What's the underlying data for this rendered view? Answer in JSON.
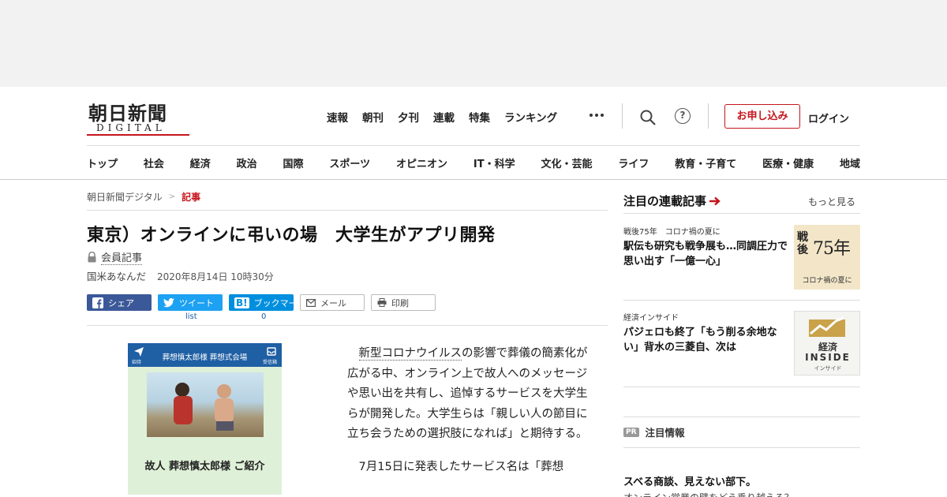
{
  "logo": {
    "jp": "朝日新聞",
    "en": "DIGITAL"
  },
  "topnav": [
    "速報",
    "朝刊",
    "夕刊",
    "連載",
    "特集",
    "ランキング"
  ],
  "header": {
    "signup": "お申し込み",
    "login": "ログイン",
    "help": "?"
  },
  "catnav": [
    "トップ",
    "社会",
    "経済",
    "政治",
    "国際",
    "スポーツ",
    "オピニオン",
    "IT・科学",
    "文化・芸能",
    "ライフ",
    "教育・子育て",
    "医療・健康",
    "地域"
  ],
  "breadcrumb": {
    "home": "朝日新聞デジタル",
    "sep": ">",
    "current": "記事"
  },
  "article": {
    "title": "東京）オンラインに弔いの場　大学生がアプリ開発",
    "member": "会員記事",
    "author": "国米あなんだ",
    "date": "2020年8月14日 10時30分",
    "share": {
      "fb": "シェア",
      "tw": "ツイート",
      "hb": "ブックマーク",
      "mail": "メール",
      "print": "印刷",
      "tw_count": "list",
      "hb_count": "0"
    },
    "photo": {
      "header": "葬想慎太郎様 葬想式会場",
      "left_label": "招待",
      "right_label": "受信箱",
      "caption": "故人 葬想慎太郎様 ご紹介"
    },
    "p1_kw": "新型コロナウイルス",
    "p1_rest": "の影響で葬儀の簡素化が広がる中、オンライン上で故人へのメッセージや思い出を共有し、追悼するサービスを大学生らが開発した。大学生らは「親しい人の節目に立ち会うための選択肢になれば」と期待する。",
    "p2": "7月15日に発表したサービス名は「葬想"
  },
  "sidebar": {
    "title": "注目の連載記事",
    "more": "もっと見る",
    "items": [
      {
        "tag": "戦後75年　コロナ禍の夏に",
        "headline": "駅伝も研究も戦争展も…同調圧力で思い出す「一億一心」",
        "thumb_top": "戦後",
        "thumb_num": "75年",
        "thumb_bottom": "コロナ禍の夏に"
      },
      {
        "tag": "経済インサイド",
        "headline": "パジェロも終了「もう削る余地ない」背水の三菱自、次は",
        "thumb_top": "経済",
        "thumb_num": "INSIDE",
        "thumb_bottom": "インサイド"
      }
    ],
    "pr": {
      "badge": "PR",
      "label": "注目情報",
      "headline": "スベる商談、見えない部下。",
      "sub": "オンライン営業の壁をどう乗り越える？"
    }
  },
  "colors": {
    "brand_red": "#c4161c",
    "facebook": "#3b5998",
    "twitter": "#1da1f2",
    "hatena": "#008fde"
  }
}
